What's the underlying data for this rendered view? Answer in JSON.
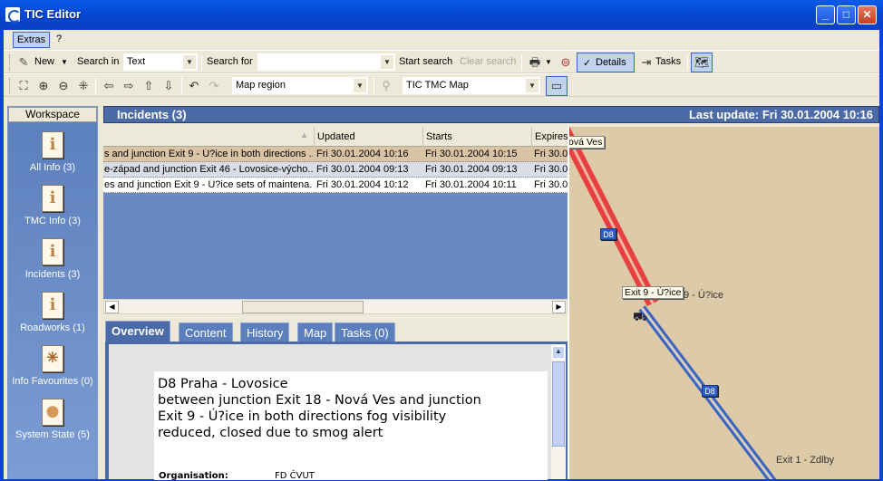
{
  "window": {
    "title": "TIC Editor",
    "controls": {
      "minimize": "_",
      "maximize": "□",
      "close": "✕"
    }
  },
  "menubar": {
    "items": [
      {
        "label": "Extras"
      },
      {
        "label": "?"
      }
    ]
  },
  "toolbar1": {
    "new_label": "New",
    "search_in_label": "Search in",
    "search_in_value": "Text",
    "search_for_label": "Search for",
    "search_for_value": "",
    "start_search": "Start search",
    "clear_search": "Clear search",
    "details_label": "Details",
    "tasks_label": "Tasks"
  },
  "toolbar2": {
    "map_region_value": "Map region",
    "map_value": "TIC TMC Map"
  },
  "workspace": {
    "header": "Workspace",
    "items": [
      {
        "label": "All Info (3)",
        "icon": "info"
      },
      {
        "label": "TMC Info (3)",
        "icon": "info"
      },
      {
        "label": "Incidents (3)",
        "icon": "info"
      },
      {
        "label": "Roadworks (1)",
        "icon": "info"
      },
      {
        "label": "Info Favourites (0)",
        "icon": "star"
      },
      {
        "label": "System State (5)",
        "icon": "ball"
      }
    ]
  },
  "list": {
    "title": "Incidents (3)",
    "last_update": "Last update: Fri 30.01.2004 10:16",
    "columns": [
      "",
      "Updated",
      "Starts",
      "Expires"
    ],
    "rows": [
      {
        "description": "s and junction Exit 9 - Ú?ice in both directions ...",
        "updated": "Fri 30.01.2004 10:16",
        "starts": "Fri 30.01.2004 10:15",
        "expires": "Fri 30.0"
      },
      {
        "description": "e-západ and junction Exit 46 - Lovosice-výcho...",
        "updated": "Fri 30.01.2004 09:13",
        "starts": "Fri 30.01.2004 09:13",
        "expires": "Fri 30.0"
      },
      {
        "description": "es and junction Exit 9 - Ú?ice sets of maintena...",
        "updated": "Fri 30.01.2004 10:12",
        "starts": "Fri 30.01.2004 10:11",
        "expires": "Fri 30.0"
      }
    ]
  },
  "detail_tabs": [
    {
      "label": "Overview"
    },
    {
      "label": "Content"
    },
    {
      "label": "History"
    },
    {
      "label": "Map"
    },
    {
      "label": "Tasks (0)"
    }
  ],
  "detail": {
    "line1": "D8 Praha - Lovosice",
    "line2": "between junction Exit 18 - Nová Ves and junction",
    "line3": "Exit 9 - Ú?ice in both directions fog visibility",
    "line4": "reduced, closed due to smog alert",
    "organisation_label": "Organisation:",
    "organisation_value": "FD ČVUT"
  },
  "map": {
    "tooltip_top": "ová Ves",
    "tooltip_exit9": "Exit 9 - Ú?ice",
    "label_exit9": "9 - Ú?ice",
    "label_exit1": "Exit 1 - Zdlby",
    "road_shield": "D8",
    "colors": {
      "closed": "#e84040",
      "open": "#3a64c0",
      "background": "#dccaa8"
    }
  }
}
